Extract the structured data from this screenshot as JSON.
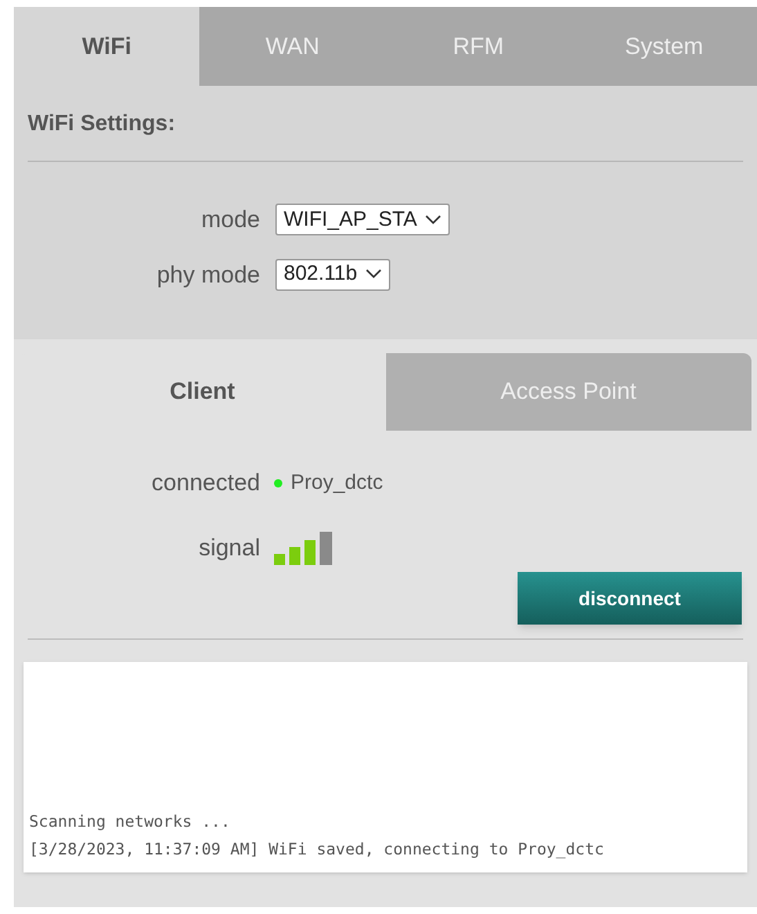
{
  "tabs": [
    {
      "label": "WiFi",
      "selected": true
    },
    {
      "label": "WAN",
      "selected": false
    },
    {
      "label": "RFM",
      "selected": false
    },
    {
      "label": "System",
      "selected": false
    }
  ],
  "section_title": "WiFi Settings:",
  "settings": [
    {
      "label": "mode",
      "value": "WIFI_AP_STA"
    },
    {
      "label": "phy mode",
      "value": "802.11b"
    }
  ],
  "subtabs": [
    {
      "label": "Client",
      "selected": true
    },
    {
      "label": "Access Point",
      "selected": false
    }
  ],
  "connection": {
    "label": "connected",
    "connected": true,
    "network": "Proy_dctc"
  },
  "signal": {
    "label": "signal"
  },
  "button": "disconnect",
  "log": [
    "Scanning networks ...",
    "[3/28/2023, 11:37:09 AM] WiFi saved, connecting to Proy_dctc"
  ]
}
